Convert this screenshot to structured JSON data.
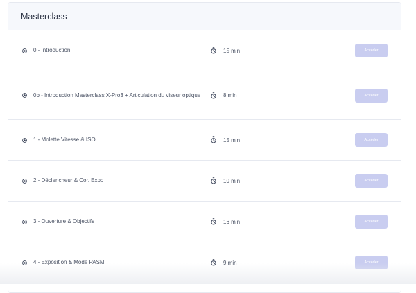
{
  "section": {
    "title": "Masterclass"
  },
  "lessons": [
    {
      "title": "0 - Introduction",
      "duration": "15 min",
      "button_label": "Accéder"
    },
    {
      "title": "0b - Introduction Masterclass X-Pro3 + Articulation du viseur optique",
      "duration": "8 min",
      "button_label": "Accéder"
    },
    {
      "title": "1 - Molette Vitesse & ISO",
      "duration": "15 min",
      "button_label": "Accéder"
    },
    {
      "title": "2 - Déclencheur & Cor. Expo",
      "duration": "10 min",
      "button_label": "Accéder"
    },
    {
      "title": "3 - Ouverture & Objectifs",
      "duration": "16 min",
      "button_label": "Accéder"
    },
    {
      "title": "4 - Exposition & Mode PASM",
      "duration": "9 min",
      "button_label": "Accéder"
    }
  ],
  "icons": {
    "play": "play-circle-icon",
    "timer": "stopwatch-icon"
  },
  "colors": {
    "accent_disabled": "#c9cdf0",
    "header_bg": "#f6f8fc",
    "text": "#4a5264"
  }
}
